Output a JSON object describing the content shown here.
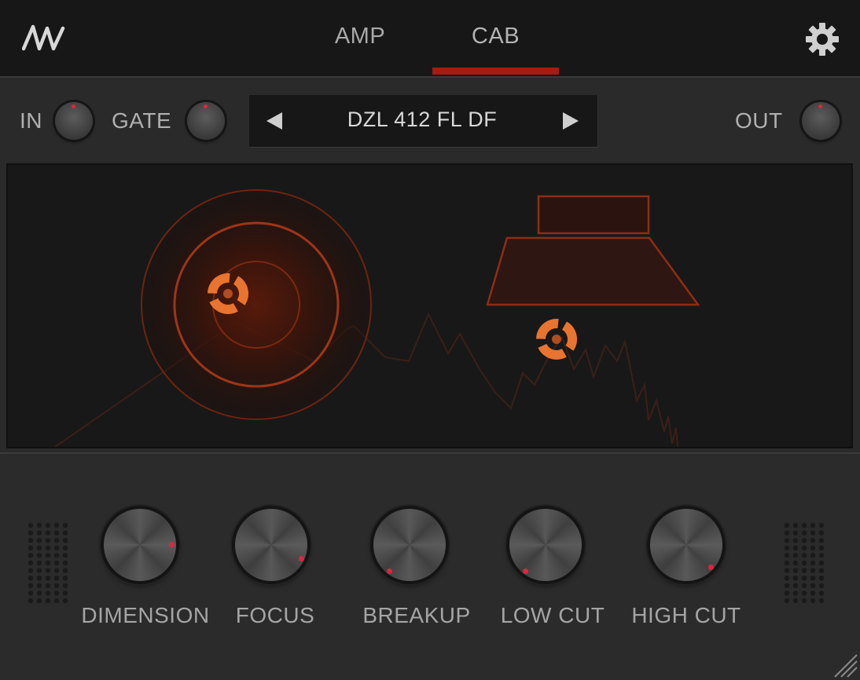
{
  "nav": {
    "tabs": [
      {
        "label": "AMP",
        "active": false
      },
      {
        "label": "CAB",
        "active": true
      }
    ]
  },
  "controls": {
    "in_label": "IN",
    "gate_label": "GATE",
    "out_label": "OUT",
    "preset_name": "DZL 412 FL DF"
  },
  "knobs": [
    {
      "label": "DIMENSION"
    },
    {
      "label": "FOCUS"
    },
    {
      "label": "BREAKUP"
    },
    {
      "label": "LOW CUT"
    },
    {
      "label": "HIGH CUT"
    }
  ],
  "colors": {
    "accent": "#a81c0c",
    "mic_orange": "#e8742f",
    "knob_dot": "#e0243e"
  },
  "icons": {
    "logo": "brand-logo-icon",
    "settings": "gear-icon",
    "prev": "triangle-left-icon",
    "next": "triangle-right-icon"
  }
}
